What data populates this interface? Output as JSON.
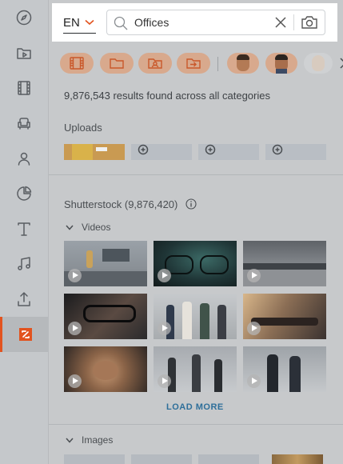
{
  "search": {
    "language": "EN",
    "query": "Offices"
  },
  "sidebar": {
    "items": [
      {
        "name": "explore"
      },
      {
        "name": "media"
      },
      {
        "name": "videos"
      },
      {
        "name": "elements"
      },
      {
        "name": "characters"
      },
      {
        "name": "charts"
      },
      {
        "name": "text"
      },
      {
        "name": "music"
      },
      {
        "name": "upload"
      },
      {
        "name": "brand"
      }
    ],
    "active_index": 9
  },
  "filters": {
    "chips": [
      "film-icon",
      "folder-icon",
      "image-folder-icon",
      "import-icon"
    ],
    "avatars": [
      "avatar-1",
      "avatar-2",
      "avatar-3"
    ]
  },
  "results_text": "9,876,543 results found across all categories",
  "uploads": {
    "title": "Uploads"
  },
  "shutterstock": {
    "title": "Shutterstock (9,876,420)",
    "videos_label": "Videos",
    "load_more": "LOAD MORE",
    "images_label": "Images"
  },
  "colors": {
    "accent": "#e2531f",
    "chip": "#d8a98d",
    "link": "#2e6f9a"
  }
}
